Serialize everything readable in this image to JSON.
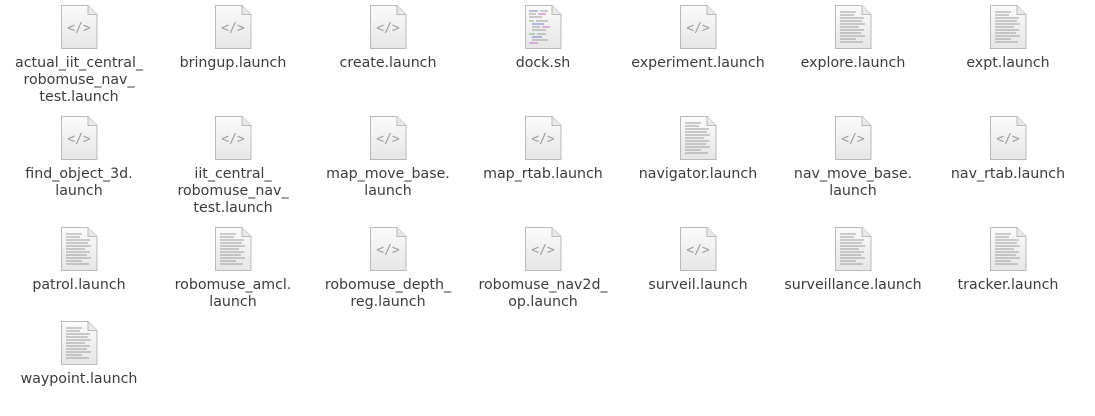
{
  "files": [
    {
      "name": "actual_iit_central_\nrobomuse_nav_\ntest.launch",
      "icon": "code-file-icon"
    },
    {
      "name": "bringup.launch",
      "icon": "code-file-icon"
    },
    {
      "name": "create.launch",
      "icon": "code-file-icon"
    },
    {
      "name": "dock.sh",
      "icon": "script-file-icon"
    },
    {
      "name": "experiment.launch",
      "icon": "code-file-icon"
    },
    {
      "name": "explore.launch",
      "icon": "text-file-icon"
    },
    {
      "name": "expt.launch",
      "icon": "text-file-icon"
    },
    {
      "name": "find_object_3d.\nlaunch",
      "icon": "code-file-icon"
    },
    {
      "name": "iit_central_\nrobomuse_nav_\ntest.launch",
      "icon": "code-file-icon"
    },
    {
      "name": "map_move_base.\nlaunch",
      "icon": "code-file-icon"
    },
    {
      "name": "map_rtab.launch",
      "icon": "code-file-icon"
    },
    {
      "name": "navigator.launch",
      "icon": "text-file-icon"
    },
    {
      "name": "nav_move_base.\nlaunch",
      "icon": "code-file-icon"
    },
    {
      "name": "nav_rtab.launch",
      "icon": "code-file-icon"
    },
    {
      "name": "patrol.launch",
      "icon": "text-file-icon"
    },
    {
      "name": "robomuse_amcl.\nlaunch",
      "icon": "text-file-icon"
    },
    {
      "name": "robomuse_depth_\nreg.launch",
      "icon": "code-file-icon"
    },
    {
      "name": "robomuse_nav2d_\nop.launch",
      "icon": "code-file-icon"
    },
    {
      "name": "surveil.launch",
      "icon": "code-file-icon"
    },
    {
      "name": "surveillance.launch",
      "icon": "text-file-icon"
    },
    {
      "name": "tracker.launch",
      "icon": "text-file-icon"
    },
    {
      "name": "waypoint.launch",
      "icon": "text-file-icon"
    }
  ]
}
